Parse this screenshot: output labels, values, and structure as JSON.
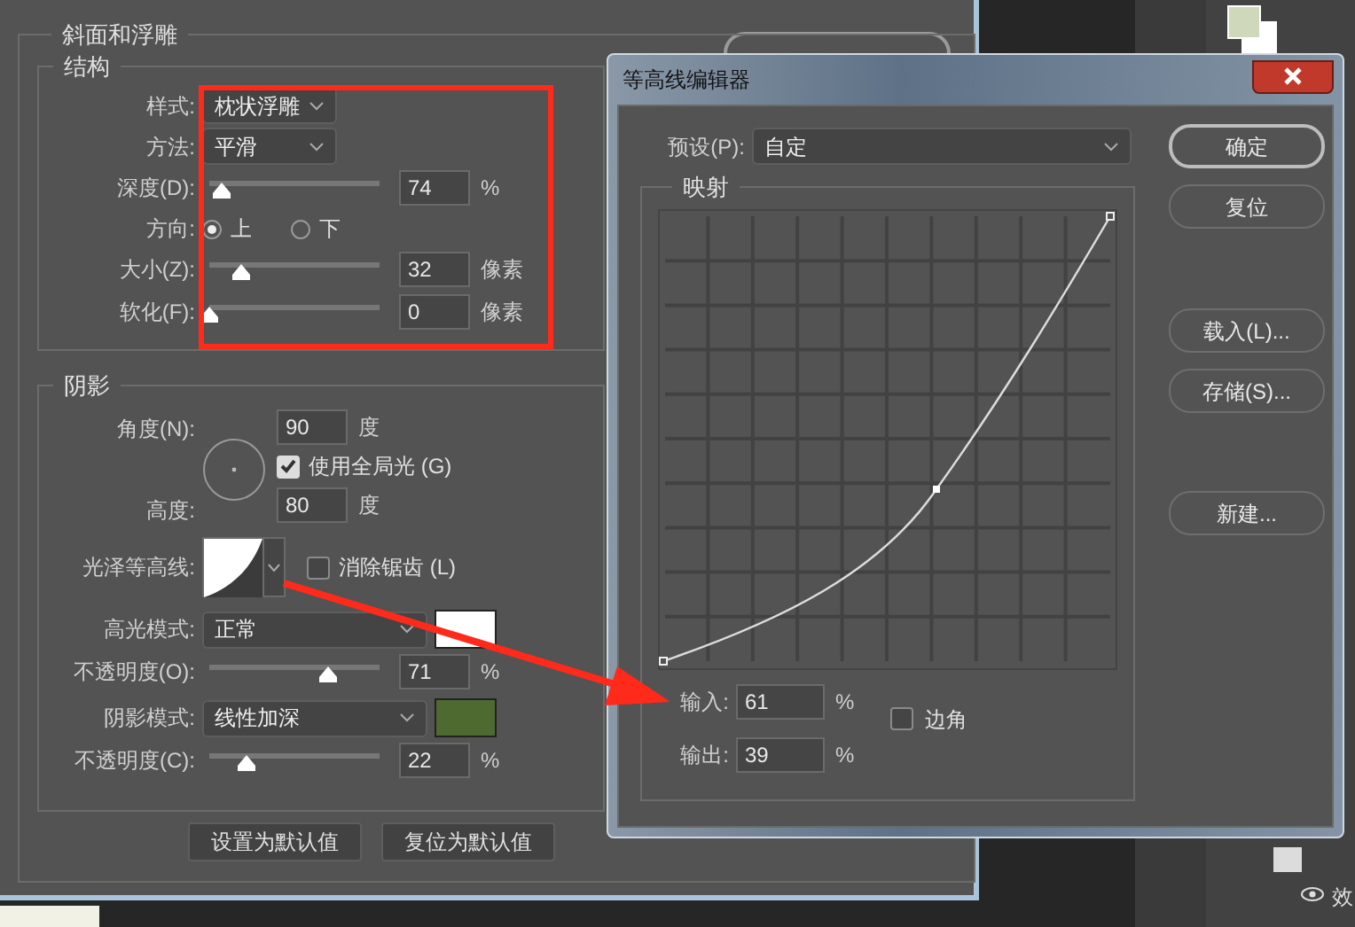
{
  "bevel_dialog": {
    "title": "斜面和浮雕",
    "structure": {
      "title": "结构",
      "style": {
        "label": "样式:",
        "value": "枕状浮雕"
      },
      "technique": {
        "label": "方法:",
        "value": "平滑"
      },
      "depth": {
        "label": "深度(D):",
        "level": 0.07,
        "value": "74",
        "unit": "%"
      },
      "direction": {
        "label": "方向:",
        "options": [
          {
            "label": "上",
            "selected": true
          },
          {
            "label": "下",
            "selected": false
          }
        ]
      },
      "size": {
        "label": "大小(Z):",
        "level": 0.19,
        "value": "32",
        "unit": "像素"
      },
      "soften": {
        "label": "软化(F):",
        "level": 0,
        "value": "0",
        "unit": "像素"
      }
    },
    "shading": {
      "title": "阴影",
      "angle": {
        "label": "角度(N):",
        "value": "90",
        "unit": "度"
      },
      "global_light": {
        "label": "使用全局光 (G)",
        "checked": true
      },
      "altitude": {
        "label": "高度:",
        "value": "80",
        "unit": "度"
      },
      "gloss_contour": {
        "label": "光泽等高线:"
      },
      "anti_aliased": {
        "label": "消除锯齿 (L)",
        "checked": false
      },
      "highlight_mode": {
        "label": "高光模式:",
        "value": "正常",
        "color": "#ffffff"
      },
      "highlight_opacity": {
        "label": "不透明度(O):",
        "level": 0.7,
        "value": "71",
        "unit": "%"
      },
      "shadow_mode": {
        "label": "阴影模式:",
        "value": "线性加深",
        "color": "#4f6a30"
      },
      "shadow_opacity": {
        "label": "不透明度(C):",
        "level": 0.22,
        "value": "22",
        "unit": "%"
      }
    },
    "buttons": [
      "设置为默认值",
      "复位为默认值"
    ]
  },
  "contour_editor": {
    "title": "等高线编辑器",
    "preset": {
      "label": "预设(P):",
      "value": "自定"
    },
    "mapping": {
      "title": "映射",
      "input": {
        "label": "输入:",
        "value": "61",
        "unit": "%"
      },
      "output": {
        "label": "输出:",
        "value": "39",
        "unit": "%"
      },
      "corner": {
        "label": "边角",
        "checked": false
      }
    },
    "buttons": [
      {
        "label": "确定",
        "default": true
      },
      {
        "label": "复位",
        "default": false
      },
      {
        "label": "载入(L)...",
        "default": false
      },
      {
        "label": "存储(S)...",
        "default": false
      },
      {
        "label": "新建...",
        "default": false
      }
    ]
  },
  "layers_panel": {
    "items": [
      {
        "label": "效"
      }
    ]
  }
}
